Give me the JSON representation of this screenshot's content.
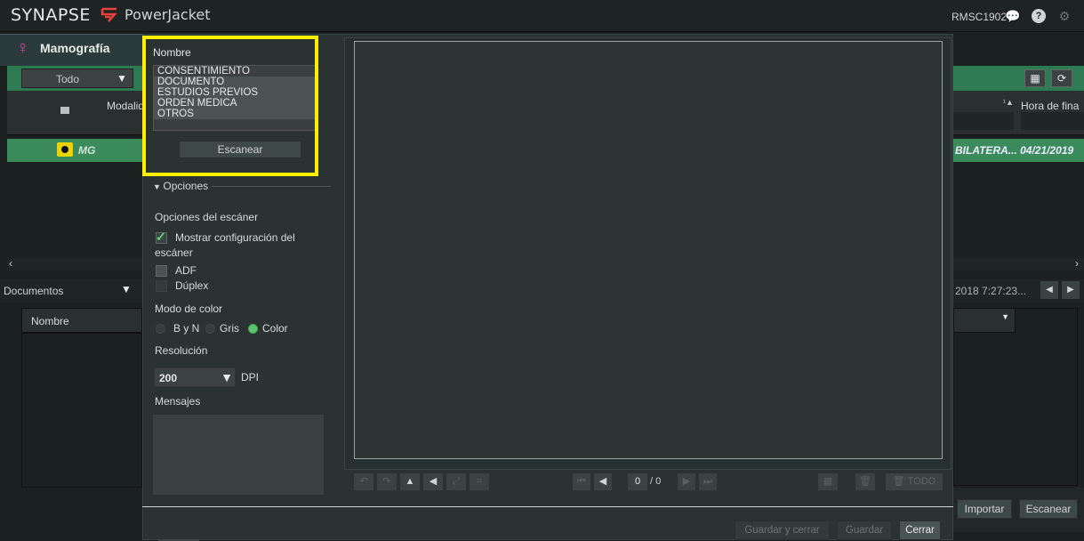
{
  "header": {
    "logo": "SYNAPSE",
    "product": "PowerJacket",
    "user": "RMSC1902",
    "icons": [
      "chat-icon",
      "help-icon",
      "gear-icon"
    ],
    "logo_mark_color": "#e8403a"
  },
  "module": {
    "title": "Mamografía",
    "filter_value": "Todo",
    "columns_left": [
      "Modalid."
    ],
    "columns_right": [
      "Hora de fina"
    ],
    "row": {
      "modality": "MG",
      "right_text": "BILATERA... 04/21/2019"
    }
  },
  "documents": {
    "selector": "Documentos",
    "date": "2018 7:27:23...",
    "column": "Nombre",
    "import_label": "Importar",
    "scan_label": "Escanear"
  },
  "dialog": {
    "name_label": "Nombre",
    "doc_types": [
      "CONSENTIMIENTO",
      "DOCUMENTO",
      "ESTUDIOS PREVIOS",
      "ORDEN MEDICA",
      "OTROS"
    ],
    "scan_button": "Escanear",
    "options_header": "Opciones",
    "scanner_options_label": "Opciones del escáner",
    "show_config_label_1": "Mostrar configuración del",
    "show_config_label_2": "escáner",
    "show_config_checked": true,
    "adf_label": "ADF",
    "adf_checked": false,
    "duplex_label": "Dúplex",
    "duplex_checked": false,
    "color_mode_label": "Modo de color",
    "color_modes": [
      "B y N",
      "Gris",
      "Color"
    ],
    "color_mode_selected": "Color",
    "resolution_label": "Resolución",
    "resolution_value": "200",
    "resolution_unit": "DPI",
    "messages_label": "Mensajes",
    "page_current": "0",
    "page_total": "/ 0",
    "todo_label": "TODO",
    "save_close_label": "Guardar y cerrar",
    "save_label": "Guardar",
    "close_label": "Cerrar",
    "highlight_color": "#ffee00"
  }
}
